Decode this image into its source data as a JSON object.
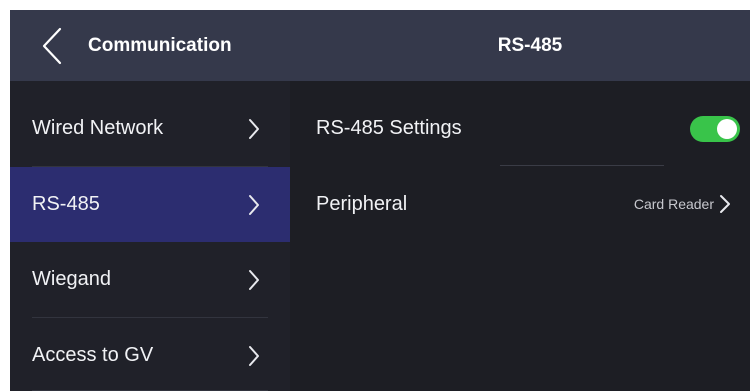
{
  "header": {
    "section_title": "Communication",
    "page_title": "RS-485"
  },
  "sidebar": {
    "items": [
      {
        "label": "Wired Network",
        "active": false
      },
      {
        "label": "RS-485",
        "active": true
      },
      {
        "label": "Wiegand",
        "active": false
      },
      {
        "label": "Access to GV",
        "active": false
      }
    ]
  },
  "settings": {
    "rs485_label": "RS-485 Settings",
    "rs485_enabled": true,
    "peripheral_label": "Peripheral",
    "peripheral_value": "Card Reader"
  },
  "colors": {
    "header_bg": "#35394b",
    "active_item_bg": "#2c2d70",
    "toggle_on": "#39c44a",
    "background": "#1d1e24"
  },
  "icons": {
    "back": "chevron-left-icon",
    "item_arrow": "chevron-right-icon"
  }
}
